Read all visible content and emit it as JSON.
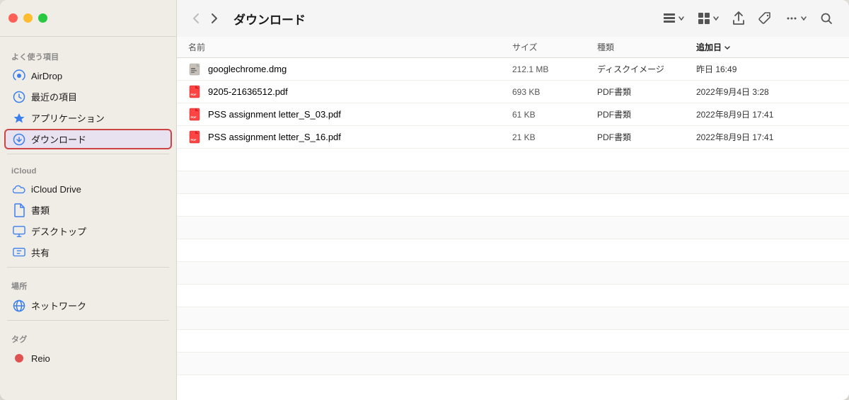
{
  "window": {
    "title": "ダウンロード"
  },
  "trafficLights": {
    "close": "close",
    "minimize": "minimize",
    "maximize": "maximize"
  },
  "sidebar": {
    "sections": [
      {
        "label": "よく使う項目",
        "items": [
          {
            "id": "airdrop",
            "icon": "airdrop",
            "label": "AirDrop",
            "active": false
          },
          {
            "id": "recents",
            "icon": "clock",
            "label": "最近の項目",
            "active": false
          },
          {
            "id": "applications",
            "icon": "rocket",
            "label": "アプリケーション",
            "active": false
          },
          {
            "id": "downloads",
            "icon": "download",
            "label": "ダウンロード",
            "active": true
          }
        ]
      },
      {
        "label": "iCloud",
        "items": [
          {
            "id": "icloud-drive",
            "icon": "cloud",
            "label": "iCloud Drive",
            "active": false
          },
          {
            "id": "documents",
            "icon": "doc",
            "label": "書類",
            "active": false
          },
          {
            "id": "desktop",
            "icon": "desktop",
            "label": "デスクトップ",
            "active": false
          },
          {
            "id": "shared",
            "icon": "shared",
            "label": "共有",
            "active": false
          }
        ]
      },
      {
        "label": "場所",
        "items": [
          {
            "id": "network",
            "icon": "network",
            "label": "ネットワーク",
            "active": false
          }
        ]
      },
      {
        "label": "タグ",
        "items": [
          {
            "id": "tag-red",
            "icon": "tag-red",
            "label": "Reio",
            "active": false,
            "tagColor": "#e05252"
          }
        ]
      }
    ]
  },
  "toolbar": {
    "back_label": "‹",
    "forward_label": "›",
    "title": "ダウンロード",
    "list_view_icon": "list-view",
    "grid_view_icon": "grid-view",
    "share_icon": "share",
    "tag_icon": "tag",
    "more_icon": "more",
    "search_icon": "search"
  },
  "fileList": {
    "columns": {
      "name": "名前",
      "size": "サイズ",
      "type": "種類",
      "date": "追加日"
    },
    "files": [
      {
        "id": "file1",
        "name": "googlechrome.dmg",
        "size": "212.1 MB",
        "type": "ディスクイメージ",
        "date": "昨日 16:49",
        "iconType": "dmg"
      },
      {
        "id": "file2",
        "name": "9205-21636512.pdf",
        "size": "693 KB",
        "type": "PDF書類",
        "date": "2022年9月4日 3:28",
        "iconType": "pdf"
      },
      {
        "id": "file3",
        "name": "PSS assignment letter_S_03.pdf",
        "size": "61 KB",
        "type": "PDF書類",
        "date": "2022年8月9日 17:41",
        "iconType": "pdf"
      },
      {
        "id": "file4",
        "name": "PSS assignment letter_S_16.pdf",
        "size": "21 KB",
        "type": "PDF書類",
        "date": "2022年8月9日 17:41",
        "iconType": "pdf"
      }
    ]
  }
}
